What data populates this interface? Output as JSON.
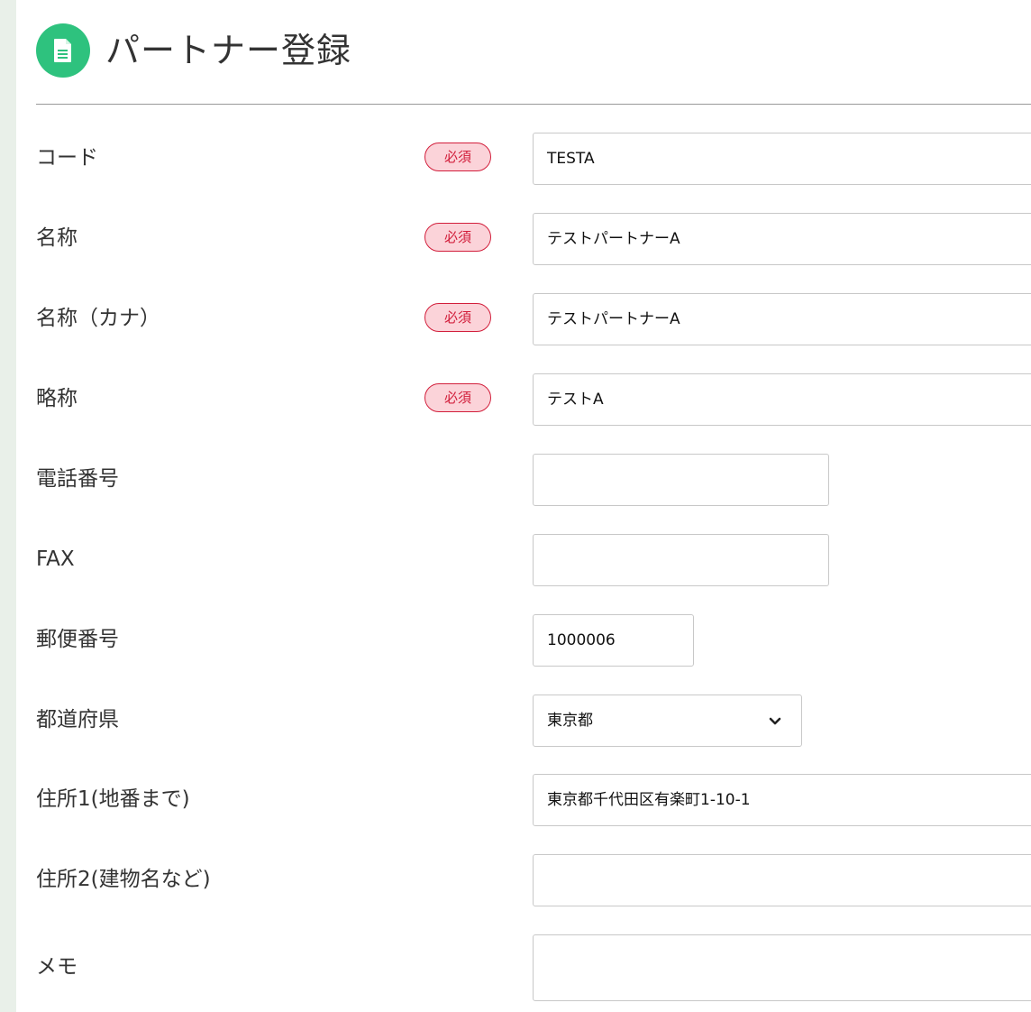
{
  "page": {
    "title": "パートナー登録",
    "icon": "document-icon",
    "accent_color": "#2ec27e"
  },
  "required_label": "必須",
  "fields": {
    "code": {
      "label": "コード",
      "required": true,
      "value": "TESTA"
    },
    "name": {
      "label": "名称",
      "required": true,
      "value": "テストパートナーA"
    },
    "name_kana": {
      "label": "名称（カナ）",
      "required": true,
      "value": "テストパートナーA"
    },
    "short_name": {
      "label": "略称",
      "required": true,
      "value": "テストA"
    },
    "phone": {
      "label": "電話番号",
      "required": false,
      "value": ""
    },
    "fax": {
      "label": "FAX",
      "required": false,
      "value": ""
    },
    "postal_code": {
      "label": "郵便番号",
      "required": false,
      "value": "1000006"
    },
    "prefecture": {
      "label": "都道府県",
      "required": false,
      "value": "東京都"
    },
    "address1": {
      "label": "住所1(地番まで)",
      "required": false,
      "value": "東京都千代田区有楽町1-10-1"
    },
    "address2": {
      "label": "住所2(建物名など)",
      "required": false,
      "value": ""
    },
    "memo": {
      "label": "メモ",
      "required": false,
      "value": ""
    }
  },
  "colors": {
    "required_badge_border": "#d21e3b",
    "required_badge_bg": "#fbd3d9"
  }
}
